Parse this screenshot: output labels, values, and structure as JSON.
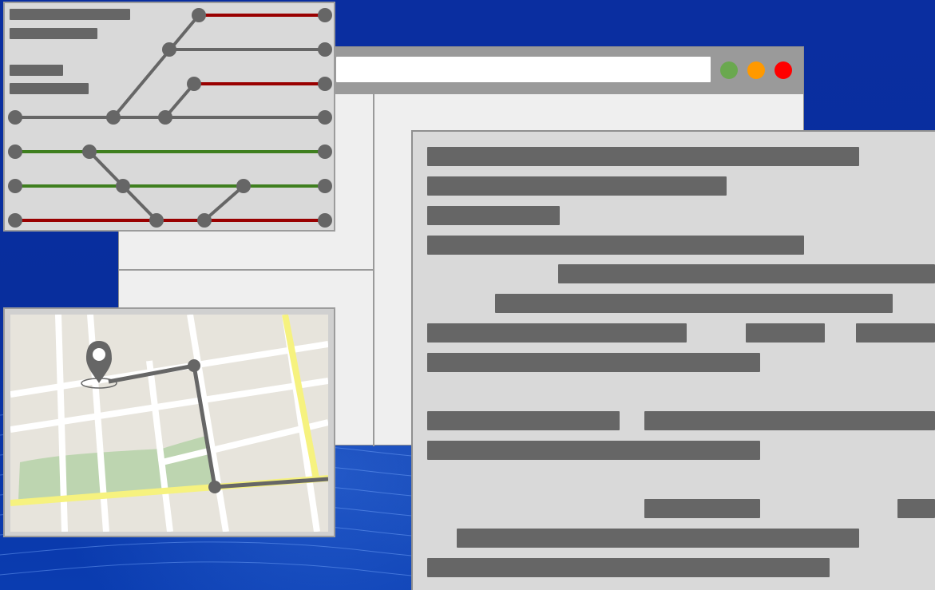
{
  "scene": {
    "background_color": "#0a2ea0",
    "browser": {
      "address_text": "",
      "window_buttons": [
        {
          "name": "green",
          "color": "#6aa84f"
        },
        {
          "name": "orange",
          "color": "#ff9900"
        },
        {
          "name": "red",
          "color": "#ff0000"
        }
      ]
    },
    "transit_diagram": {
      "labels": [
        "",
        "",
        "",
        ""
      ],
      "line_colors": {
        "gray": "#666666",
        "red": "#990000",
        "green": "#3f7f1f"
      }
    },
    "map": {
      "route_color": "#666666",
      "highlight_road_color": "#f6f27f",
      "park_color": "#bdd5b0",
      "street_color": "#ffffff",
      "pin_icon": "location-pin-icon"
    },
    "document": {
      "line_color": "#666666"
    }
  }
}
